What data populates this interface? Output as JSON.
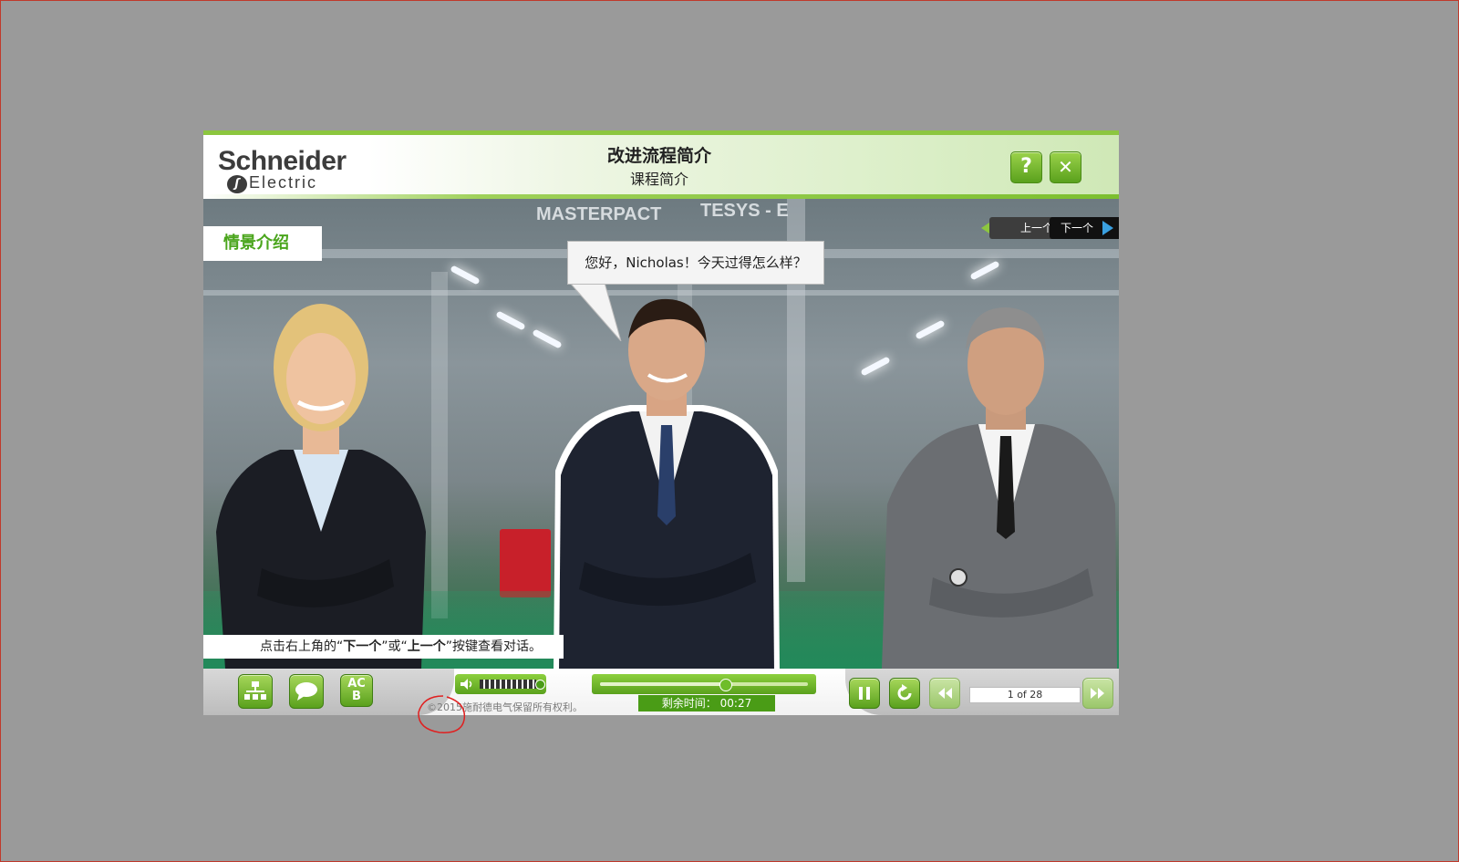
{
  "header": {
    "logo_top": "Schneider",
    "logo_bottom": "Electric",
    "title": "改进流程简介",
    "subtitle": "课程简介",
    "help_label": "?",
    "close_label": "✕"
  },
  "scene": {
    "tag": "情景介绍",
    "prev_label": "上一个",
    "next_label": "下一个",
    "speech": "您好，Nicholas！今天过得怎么样？",
    "sign_left": "MASTERPACT",
    "sign_right": "TESYS - E",
    "hint_prefix": "点击右上角的“",
    "hint_next": "下一个",
    "hint_mid": "”或“",
    "hint_prev": "上一个",
    "hint_suffix": "”按键查看对话。"
  },
  "controls": {
    "menu_icon": "sitemap-icon",
    "transcript_icon": "speech-bubble-icon",
    "glossary_label_top": "AC",
    "glossary_label_bottom": "B",
    "volume_icon": "speaker-icon",
    "progress_fraction": 0.6,
    "time_label": "剩余时间：",
    "time_value": "00:27",
    "copyright": "©2015施耐德电气保留所有权利。",
    "page_indicator": "1 of 28"
  },
  "colors": {
    "brand_green": "#5aa11d",
    "annotation_red": "#e02020"
  }
}
